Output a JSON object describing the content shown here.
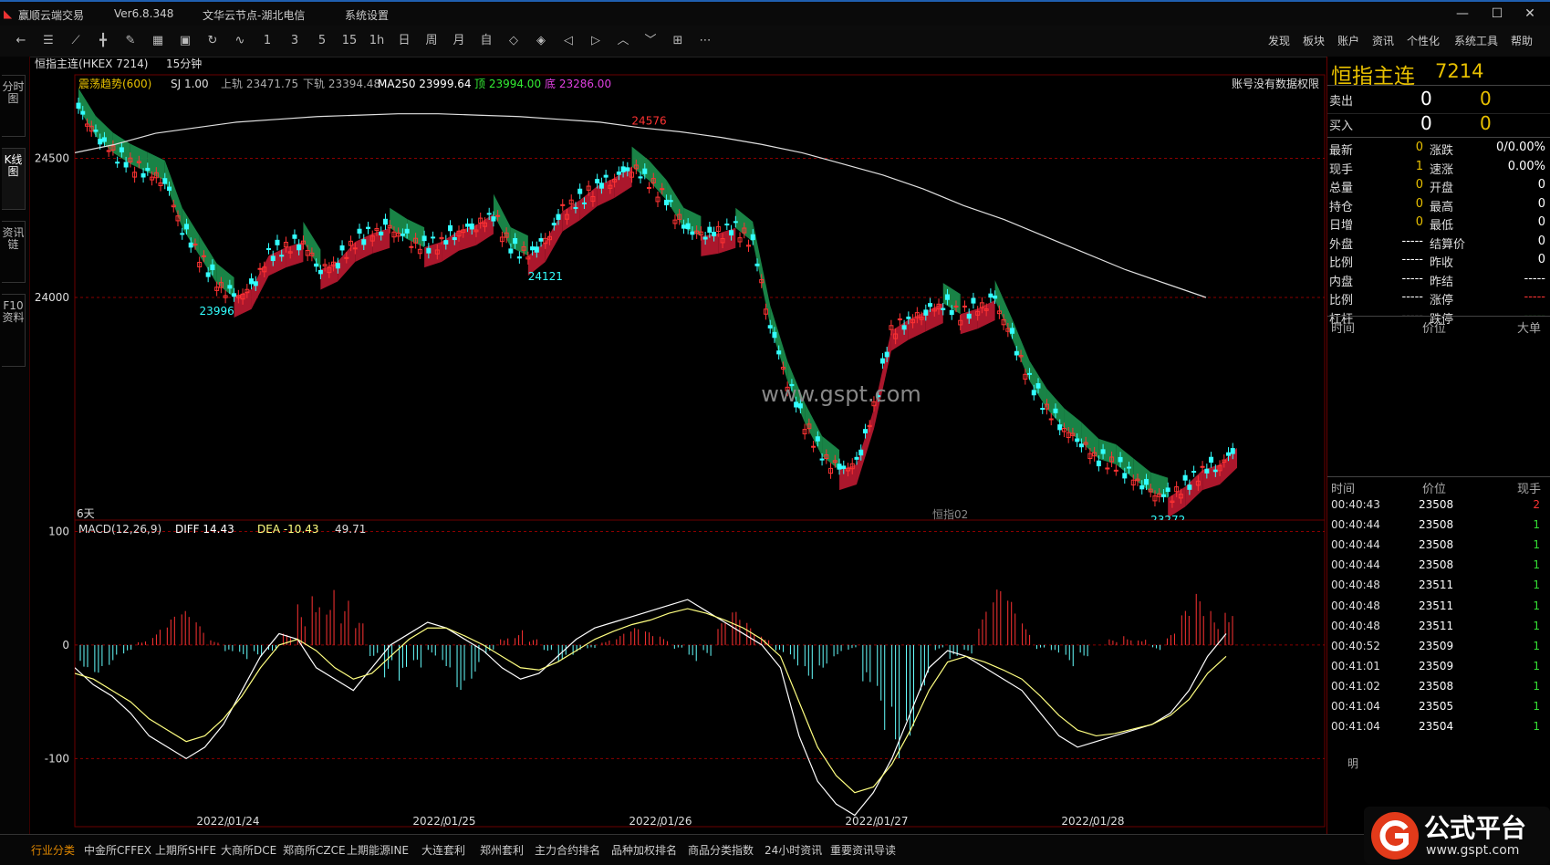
{
  "window": {
    "app_title": "赢顺云端交易",
    "version": "Ver6.8.348",
    "node": "文华云节点-湖北电信",
    "menu_sys": "系统设置",
    "buttons": {
      "min": "—",
      "max": "☐",
      "close": "✕"
    }
  },
  "toolbar": {
    "icons": [
      "back-icon",
      "list-icon",
      "line-icon",
      "candle-icon",
      "draw-icon",
      "table-icon",
      "save-icon",
      "refresh-icon",
      "indicator-icon"
    ],
    "periods": [
      "1",
      "3",
      "5",
      "15",
      "1h",
      "日",
      "周",
      "月",
      "自"
    ],
    "nav_icons": [
      "shrink-icon",
      "expand-icon",
      "left-icon",
      "right-icon",
      "up-icon",
      "down-icon",
      "grid-icon",
      "more-icon"
    ],
    "menus": [
      "发现",
      "板块",
      "账户",
      "资讯",
      "个性化",
      "系统工具",
      "帮助"
    ]
  },
  "rail": {
    "tabs": [
      "分时图",
      "K线图",
      "资讯链",
      "F10资料"
    ]
  },
  "chart_header": {
    "symbol": "恒指主连(HKEX 7214)",
    "period": "15分钟",
    "indicator": "震荡趋势(600)",
    "sj": "SJ 1.00",
    "upper": "上轨 23471.75",
    "lower": "下轨 23394.48",
    "ma": "MA250 23999.64",
    "top_label": "顶 23994.00",
    "bottom_label": "底 23286.00",
    "notice": "账号没有数据权限",
    "days": "6天",
    "watermark_center": "恒指02",
    "site": "www.gspt.com"
  },
  "macd_header": {
    "name": "MACD(12,26,9)",
    "diff": "DIFF 14.43",
    "dea": "DEA -10.43",
    "macd": "49.71"
  },
  "chart_data": [
    {
      "type": "line",
      "title": "恒指主连 15分钟",
      "ylim": [
        23200,
        24800
      ],
      "yticks": [
        24000,
        24500
      ],
      "x_ticks": [
        "2022/01/24",
        "2022/01/25",
        "2022/01/26",
        "2022/01/27",
        "2022/01/28"
      ],
      "series": [
        {
          "name": "price",
          "values": [
            24680,
            24580,
            24520,
            24480,
            24450,
            24420,
            24250,
            24150,
            24050,
            24000,
            24030,
            24150,
            24180,
            24200,
            24100,
            24130,
            24200,
            24230,
            24250,
            24210,
            24180,
            24200,
            24240,
            24260,
            24300,
            24180,
            24150,
            24200,
            24310,
            24350,
            24400,
            24430,
            24470,
            24420,
            24350,
            24250,
            24220,
            24230,
            24250,
            24200,
            23900,
            23700,
            23550,
            23430,
            23380,
            23400,
            23600,
            23880,
            23920,
            23950,
            23980,
            23940,
            23960,
            23990,
            23850,
            23700,
            23600,
            23530,
            23480,
            23420,
            23400,
            23350,
            23300,
            23280,
            23320,
            23380,
            23400,
            23460
          ]
        },
        {
          "name": "MA250",
          "values": [
            24520,
            24550,
            24590,
            24610,
            24630,
            24640,
            24650,
            24655,
            24660,
            24660,
            24655,
            24650,
            24640,
            24630,
            24610,
            24595,
            24575,
            24550,
            24520,
            24480,
            24440,
            24390,
            24330,
            24280,
            24220,
            24160,
            24100,
            24050,
            24000
          ]
        }
      ],
      "annotations": {
        "low1": "23996",
        "low2": "24121",
        "low3": "23272",
        "high1": "24576"
      }
    },
    {
      "type": "bar",
      "title": "MACD(12,26,9)",
      "ylim": [
        -160,
        110
      ],
      "yticks": [
        100,
        0,
        -100
      ],
      "series": [
        {
          "name": "MACD",
          "values": [
            -20,
            -25,
            -18,
            -10,
            5,
            15,
            25,
            30,
            20,
            5,
            -10,
            -15,
            -10,
            -5,
            10,
            40,
            70,
            65,
            40,
            20,
            -10,
            -30,
            -45,
            -30,
            -10,
            -20,
            -40,
            -30,
            -10,
            10,
            15,
            5,
            -5,
            -15,
            -10,
            -5,
            5,
            10,
            15,
            12,
            8,
            -5,
            -20,
            -10,
            20,
            30,
            20,
            10,
            -10,
            -20,
            -30,
            -20,
            -10,
            -5,
            -60,
            -90,
            -100,
            -80,
            -40,
            -5,
            -20,
            -10,
            30,
            50,
            40,
            20,
            -5,
            -10,
            -20,
            -10,
            0,
            5,
            10,
            8,
            -5,
            10,
            30,
            45,
            35,
            50
          ]
        },
        {
          "name": "DIFF",
          "values": [
            -20,
            -35,
            -45,
            -60,
            -80,
            -90,
            -100,
            -90,
            -70,
            -40,
            -10,
            10,
            5,
            -20,
            -30,
            -40,
            -20,
            0,
            10,
            20,
            15,
            5,
            -5,
            -20,
            -30,
            -25,
            -10,
            5,
            15,
            20,
            25,
            30,
            35,
            40,
            30,
            20,
            10,
            0,
            -20,
            -80,
            -120,
            -140,
            -150,
            -130,
            -100,
            -60,
            -20,
            -5,
            -10,
            -20,
            -30,
            -40,
            -60,
            -80,
            -90,
            -85,
            -80,
            -75,
            -70,
            -60,
            -40,
            -10,
            10
          ]
        },
        {
          "name": "DEA",
          "values": [
            -25,
            -30,
            -40,
            -50,
            -65,
            -75,
            -85,
            -80,
            -65,
            -45,
            -20,
            0,
            5,
            -5,
            -20,
            -30,
            -25,
            -10,
            5,
            15,
            15,
            8,
            0,
            -10,
            -20,
            -22,
            -15,
            -5,
            5,
            12,
            18,
            22,
            28,
            32,
            28,
            22,
            15,
            5,
            -10,
            -50,
            -90,
            -115,
            -130,
            -125,
            -105,
            -75,
            -40,
            -15,
            -10,
            -15,
            -22,
            -30,
            -45,
            -62,
            -75,
            -80,
            -78,
            -74,
            -70,
            -62,
            -48,
            -25,
            -10
          ]
        }
      ]
    }
  ],
  "quote_panel": {
    "title": "恒指主连",
    "code": "7214",
    "sell_label": "卖出",
    "sell_price": "0",
    "sell_vol": "0",
    "buy_label": "买入",
    "buy_price": "0",
    "buy_vol": "0",
    "rows": [
      {
        "l1": "最新",
        "v1": "0",
        "l2": "涨跌",
        "v2": "0/0.00%"
      },
      {
        "l1": "现手",
        "v1": "1",
        "l2": "速涨",
        "v2": "0.00%"
      },
      {
        "l1": "总量",
        "v1": "0",
        "l2": "开盘",
        "v2": "0"
      },
      {
        "l1": "持仓",
        "v1": "0",
        "l2": "最高",
        "v2": "0"
      },
      {
        "l1": "日增",
        "v1": "0",
        "l2": "最低",
        "v2": "0"
      },
      {
        "l1": "外盘",
        "v1": "-----",
        "l2": "结算价",
        "v2": "0"
      },
      {
        "l1": "比例",
        "v1": "-----",
        "l2": "昨收",
        "v2": "0"
      },
      {
        "l1": "内盘",
        "v1": "-----",
        "l2": "昨结",
        "v2": "-----"
      },
      {
        "l1": "比例",
        "v1": "-----",
        "l2": "涨停",
        "v2": "-----"
      },
      {
        "l1": "杠杆",
        "v1": "-----",
        "l2": "跌停",
        "v2": "-----"
      }
    ],
    "big_header": {
      "time": "时间",
      "price": "价位",
      "big": "大单"
    },
    "tick_header": {
      "time": "时间",
      "price": "价位",
      "vol": "现手"
    },
    "ticks": [
      {
        "time": "00:40:43",
        "price": "23508",
        "vol": "2"
      },
      {
        "time": "00:40:44",
        "price": "23508",
        "vol": "1"
      },
      {
        "time": "00:40:44",
        "price": "23508",
        "vol": "1"
      },
      {
        "time": "00:40:44",
        "price": "23508",
        "vol": "1"
      },
      {
        "time": "00:40:48",
        "price": "23511",
        "vol": "1"
      },
      {
        "time": "00:40:48",
        "price": "23511",
        "vol": "1"
      },
      {
        "time": "00:40:48",
        "price": "23511",
        "vol": "1"
      },
      {
        "time": "00:40:52",
        "price": "23509",
        "vol": "1"
      },
      {
        "time": "00:41:01",
        "price": "23509",
        "vol": "1"
      },
      {
        "time": "00:41:02",
        "price": "23508",
        "vol": "1"
      },
      {
        "time": "00:41:04",
        "price": "23505",
        "vol": "1"
      },
      {
        "time": "00:41:04",
        "price": "23504",
        "vol": "1"
      }
    ],
    "detail_btn": "明"
  },
  "bottom_tabs": [
    "行业分类",
    "中金所CFFEX",
    "上期所SHFE",
    "大商所DCE",
    "郑商所CZCE",
    "上期能源INE",
    "大连套利",
    "郑州套利",
    "主力合约排名",
    "品种加权排名",
    "商品分类指数",
    "24小时资讯",
    "重要资讯导读"
  ],
  "logo": {
    "text": "公式平台",
    "url": "www.gspt.com"
  },
  "colors": {
    "up": "#ff3333",
    "down": "#33ffff",
    "ribbon_bull": "#b4182e",
    "ribbon_bear": "#1a8a4a",
    "ma": "#e0e0e0",
    "diff": "#ffffff",
    "dea": "#ffff80",
    "grid": "#6a0000"
  }
}
